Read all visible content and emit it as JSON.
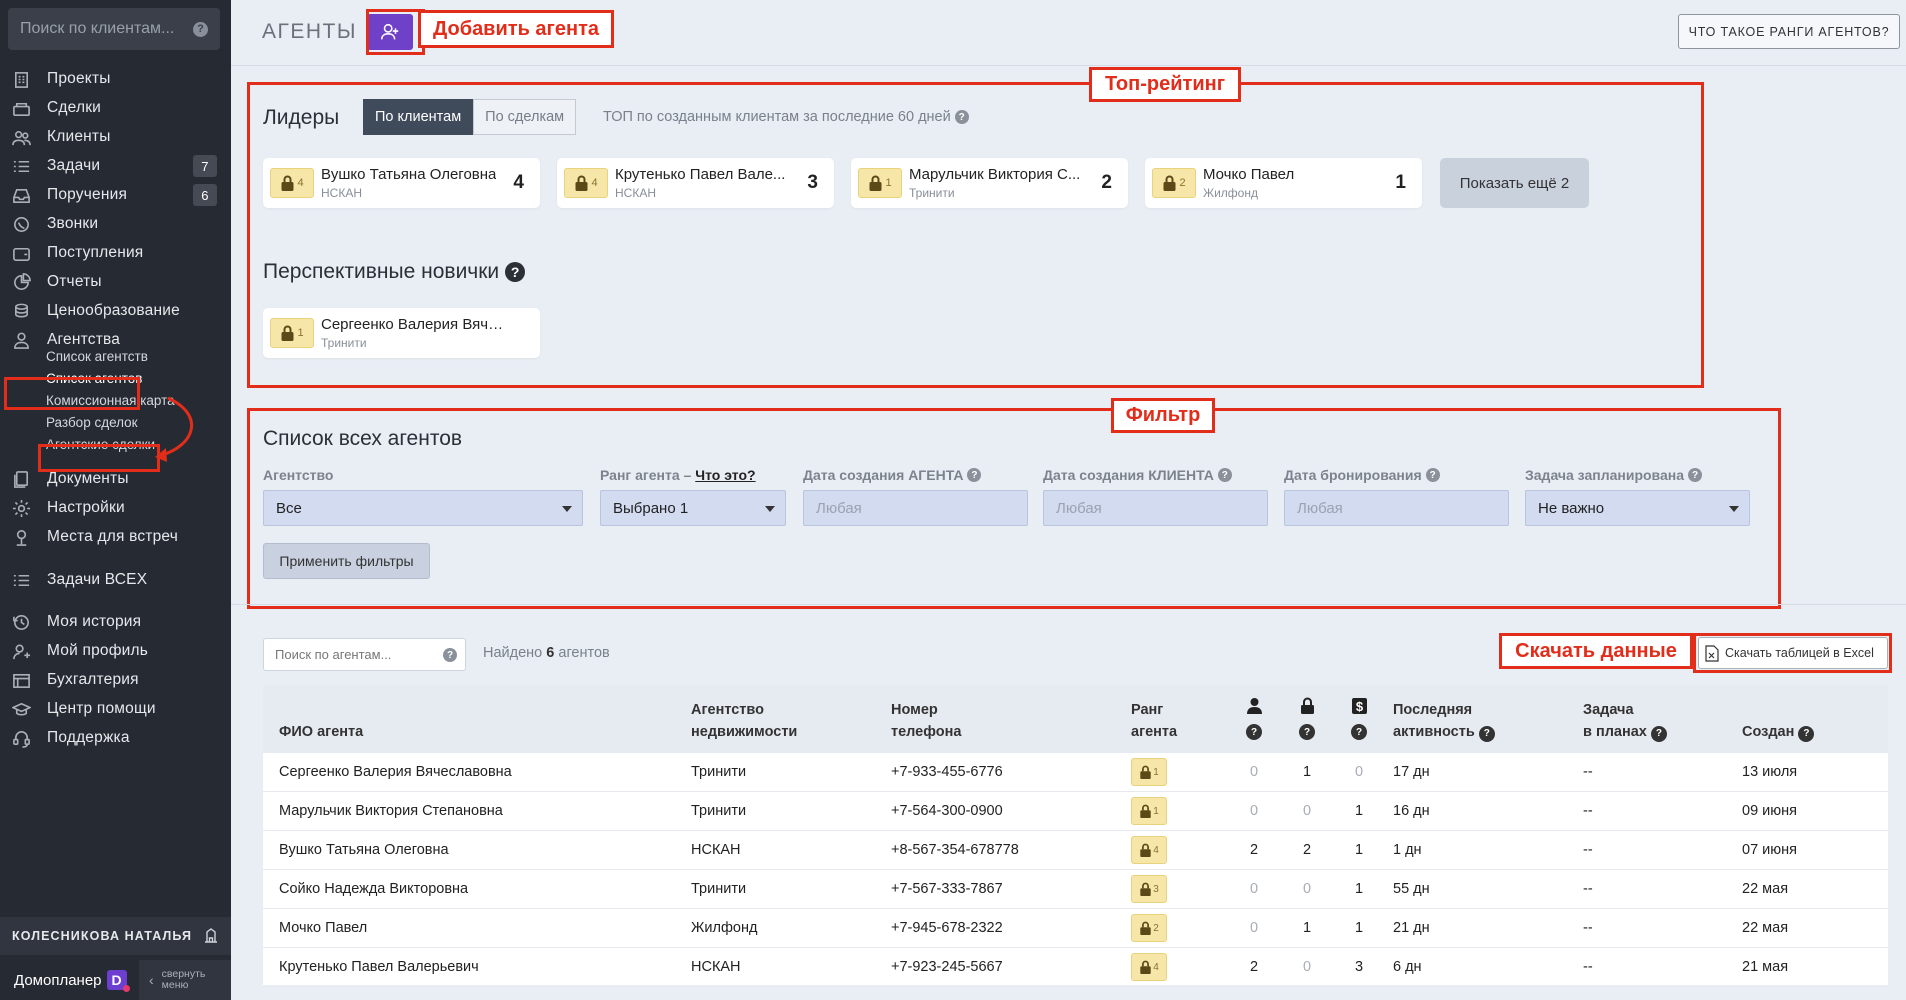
{
  "sidebar": {
    "search_placeholder": "Поиск по клиентам...",
    "nav": [
      {
        "label": "Проекты",
        "icon": "building-icon"
      },
      {
        "label": "Сделки",
        "icon": "handshake-icon"
      },
      {
        "label": "Клиенты",
        "icon": "people-icon"
      },
      {
        "label": "Задачи",
        "icon": "checklist-icon",
        "badge": "7"
      },
      {
        "label": "Поручения",
        "icon": "inbox-icon",
        "badge": "6"
      },
      {
        "label": "Звонки",
        "icon": "phone-icon"
      },
      {
        "label": "Поступления",
        "icon": "wallet-icon"
      },
      {
        "label": "Отчеты",
        "icon": "pie-chart-icon"
      },
      {
        "label": "Ценообразование",
        "icon": "coins-icon"
      },
      {
        "label": "Агентства",
        "icon": "agency-icon"
      }
    ],
    "sub_nav": [
      "Список агентств",
      "Список агентов",
      "Комиссионная карта",
      "Разбор сделок",
      "Агентские сделки"
    ],
    "nav2": [
      {
        "label": "Документы",
        "icon": "documents-icon"
      },
      {
        "label": "Настройки",
        "icon": "gear-icon"
      },
      {
        "label": "Места для встреч",
        "icon": "pin-icon"
      },
      {
        "label": "Задачи ВСЕХ",
        "icon": "checklist-icon"
      },
      {
        "label": "Моя история",
        "icon": "history-icon"
      },
      {
        "label": "Мой профиль",
        "icon": "profile-icon"
      },
      {
        "label": "Бухгалтерия",
        "icon": "ledger-icon"
      },
      {
        "label": "Центр помощи",
        "icon": "graduation-icon"
      },
      {
        "label": "Поддержка",
        "icon": "headset-icon"
      }
    ],
    "user_name": "КОЛЕСНИКОВА НАТАЛЬЯ",
    "brand": "Домопланер",
    "brand_letter": "D",
    "collapse_line1": "свернуть",
    "collapse_line2": "меню"
  },
  "header": {
    "title": "АГЕНТЫ",
    "rank_button": "ЧТО ТАКОЕ РАНГИ АГЕНТОВ?"
  },
  "annotations": {
    "add_agent": "Добавить агента",
    "top_rating": "Топ-рейтинг",
    "filter": "Фильтр",
    "download": "Скачать данные"
  },
  "leaders": {
    "title": "Лидеры",
    "tab_clients": "По клиентам",
    "tab_deals": "По сделкам",
    "hint": "ТОП по созданным клиентам за последние 60 дней",
    "cards": [
      {
        "name": "Вушко Татьяна Олеговна",
        "agency": "НСКАН",
        "rank": "4",
        "count": "4"
      },
      {
        "name": "Крутенько Павел Вале...",
        "agency": "НСКАН",
        "rank": "4",
        "count": "3"
      },
      {
        "name": "Марульчик Виктория С...",
        "agency": "Тринити",
        "rank": "1",
        "count": "2"
      },
      {
        "name": "Мочко Павел",
        "agency": "Жилфонд",
        "rank": "2",
        "count": "1"
      }
    ],
    "more_button": "Показать ещё 2"
  },
  "newbies": {
    "title": "Перспективные новички",
    "cards": [
      {
        "name": "Сергеенко Валерия Вячесл...",
        "agency": "Тринити",
        "rank": "1"
      }
    ]
  },
  "filters": {
    "title": "Список всех агентов",
    "agency_label": "Агентство",
    "agency_value": "Все",
    "rank_label": "Ранг агента –",
    "rank_what": "Что это?",
    "rank_value": "Выбрано 1",
    "agent_date_label": "Дата создания АГЕНТА",
    "agent_date_ph": "Любая",
    "client_date_label": "Дата создания КЛИЕНТА",
    "client_date_ph": "Любая",
    "booking_label": "Дата бронирования",
    "booking_ph": "Любая",
    "task_label": "Задача запланирована",
    "task_value": "Не важно",
    "apply": "Применить фильтры"
  },
  "list": {
    "search_placeholder": "Поиск по агентам...",
    "found_prefix": "Найдено",
    "found_count": "6",
    "found_suffix": "агентов",
    "excel_button": "Скачать таблицей в Excel"
  },
  "table": {
    "headers": {
      "name": "ФИО агента",
      "agency_1": "Агентство",
      "agency_2": "недвижимости",
      "phone_1": "Номер",
      "phone_2": "телефона",
      "rank_1": "Ранг",
      "rank_2": "агента",
      "activity_1": "Последняя",
      "activity_2": "активность",
      "task_1": "Задача",
      "task_2": "в планах",
      "created": "Создан"
    },
    "rows": [
      {
        "name": "Сергеенко Валерия Вячеславовна",
        "agency": "Тринити",
        "phone": "+7-933-455-6776",
        "rank": "1",
        "clients": "0",
        "bookings": "1",
        "deals": "0",
        "activity": "17 дн",
        "task": "--",
        "created": "13 июля"
      },
      {
        "name": "Марульчик Виктория Степановна",
        "agency": "Тринити",
        "phone": "+7-564-300-0900",
        "rank": "1",
        "clients": "0",
        "bookings": "0",
        "deals": "1",
        "activity": "16 дн",
        "task": "--",
        "created": "09 июня"
      },
      {
        "name": "Вушко Татьяна Олеговна",
        "agency": "НСКАН",
        "phone": "+8-567-354-678778",
        "rank": "4",
        "clients": "2",
        "bookings": "2",
        "deals": "1",
        "activity": "1 дн",
        "task": "--",
        "created": "07 июня"
      },
      {
        "name": "Сойко Надежда Викторовна",
        "agency": "Тринити",
        "phone": "+7-567-333-7867",
        "rank": "3",
        "clients": "0",
        "bookings": "0",
        "deals": "1",
        "activity": "55 дн",
        "task": "--",
        "created": "22 мая"
      },
      {
        "name": "Мочко Павел",
        "agency": "Жилфонд",
        "phone": "+7-945-678-2322",
        "rank": "2",
        "clients": "0",
        "bookings": "1",
        "deals": "1",
        "activity": "21 дн",
        "task": "--",
        "created": "22 мая"
      },
      {
        "name": "Крутенько Павел Валерьевич",
        "agency": "НСКАН",
        "phone": "+7-923-245-5667",
        "rank": "4",
        "clients": "2",
        "bookings": "0",
        "deals": "3",
        "activity": "6 дн",
        "task": "--",
        "created": "21 мая"
      }
    ]
  },
  "colors": {
    "accent": "#6f41c9",
    "annotation": "#e12d1a",
    "sidebar": "#262a33",
    "rank_chip": "#f6e6a8"
  }
}
